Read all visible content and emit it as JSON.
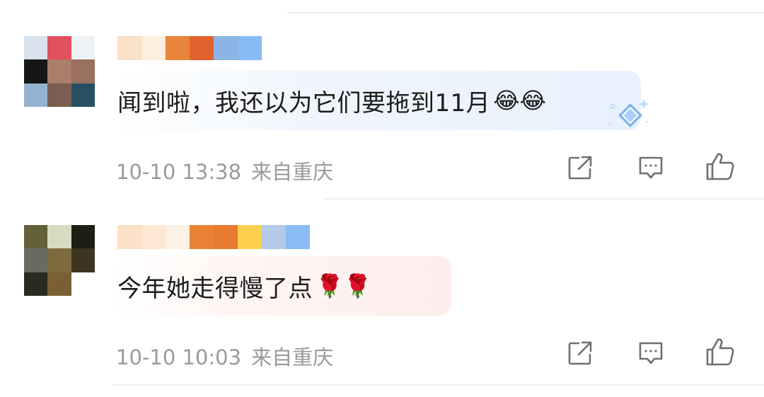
{
  "comments": [
    {
      "text": "闻到啦，我还以为它们要拖到11月",
      "emoji": "😂😂",
      "time": "10-10 13:38",
      "location": "来自重庆",
      "avatar_colors": [
        "#d8e3ee",
        "#e0505e",
        "#eef2f5",
        "#161616",
        "#a97e6a",
        "#9a7160",
        "#95b3d0",
        "#7a5e52",
        "#275161"
      ],
      "username_colors": [
        "#fbe1c7",
        "#fdeedd",
        "#e8853a",
        "#e2622f",
        "#8db4e6",
        "#86bbf5"
      ]
    },
    {
      "text": "今年她走得慢了点",
      "emoji": "🌹🌹",
      "time": "10-10 10:03",
      "location": "来自重庆",
      "avatar_colors": [
        "#62613a",
        "#d9dbc0",
        "#1e1f14",
        "#696b5e",
        "#7e6a3e",
        "#3c3621",
        "#2a2a1e",
        "#7a5f35",
        "#ffffff"
      ],
      "username_colors": [
        "#fbe1c7",
        "#fde8d4",
        "#fdf0e4",
        "#e88234",
        "#e67a2e",
        "#fccf4d",
        "#b3c9e6",
        "#8bbcf6"
      ]
    }
  ],
  "icons": {
    "share": "share-icon",
    "reply": "comment-icon",
    "like": "thumbs-up-icon",
    "badge": "diamond-badge-icon"
  },
  "colors": {
    "meta_text": "#9a9a9a",
    "icon_stroke": "#6f6f6f",
    "bubble_blue": "#e7f0fc",
    "bubble_pink": "#fdeeec"
  }
}
